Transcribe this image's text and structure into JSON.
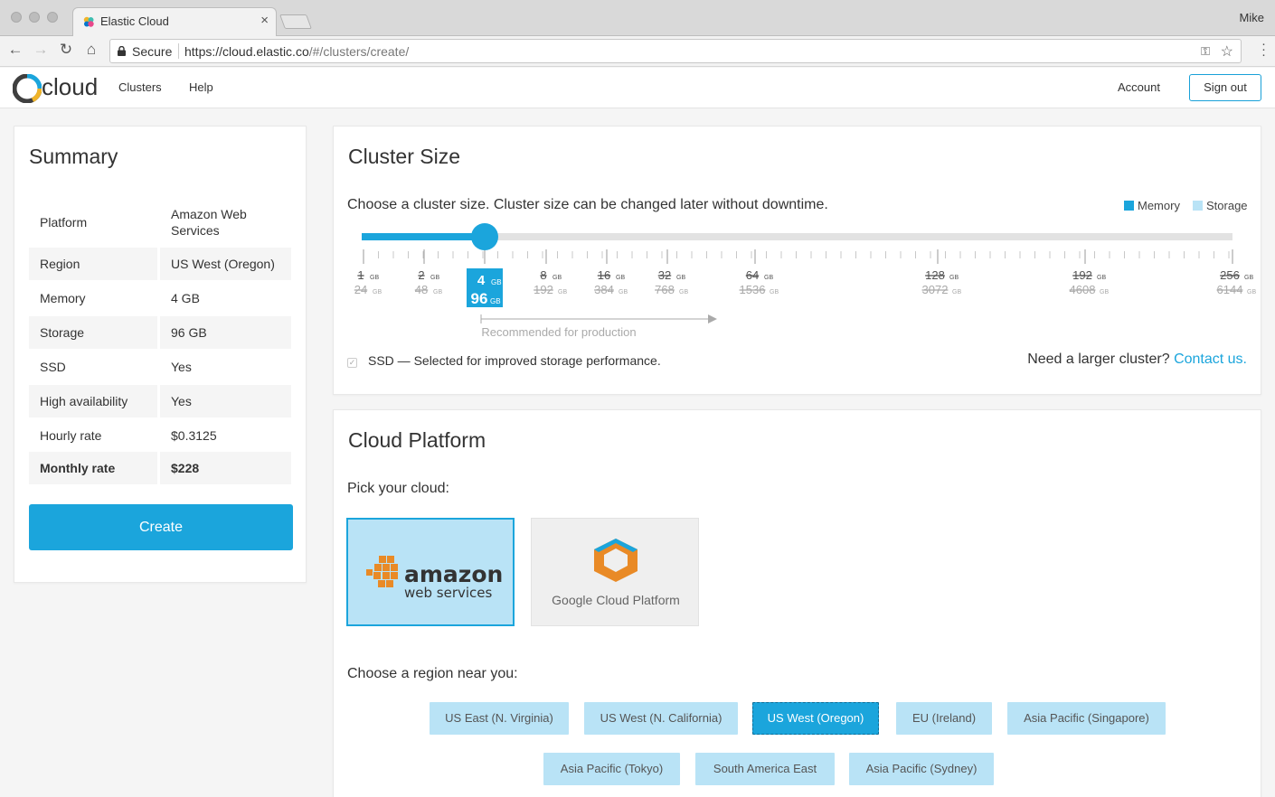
{
  "browser": {
    "tab_title": "Elastic Cloud",
    "user": "Mike",
    "secure_label": "Secure",
    "url_host": "https://cloud.elastic.co",
    "url_path": "/#/clusters/create/"
  },
  "appbar": {
    "logo_text": "cloud",
    "nav": [
      "Clusters",
      "Help"
    ],
    "account": "Account",
    "sign_out": "Sign out"
  },
  "summary": {
    "title": "Summary",
    "rows": [
      {
        "key": "Platform",
        "value": "Amazon Web Services"
      },
      {
        "key": "Region",
        "value": "US West (Oregon)"
      },
      {
        "key": "Memory",
        "value": "4 GB"
      },
      {
        "key": "Storage",
        "value": "96 GB"
      },
      {
        "key": "SSD",
        "value": "Yes"
      },
      {
        "key": "High availability",
        "value": "Yes"
      },
      {
        "key": "Hourly rate",
        "value": "$0.3125"
      },
      {
        "key": "Monthly rate",
        "value": "$228"
      }
    ],
    "create": "Create"
  },
  "cluster_size": {
    "title": "Cluster Size",
    "description": "Choose a cluster size. Cluster size can be changed later without downtime.",
    "legend_memory": "Memory",
    "legend_storage": "Storage",
    "unit": "GB",
    "sizes": [
      {
        "memory": "1",
        "storage": "24"
      },
      {
        "memory": "2",
        "storage": "48"
      },
      {
        "memory": "4",
        "storage": "96"
      },
      {
        "memory": "8",
        "storage": "192"
      },
      {
        "memory": "16",
        "storage": "384"
      },
      {
        "memory": "32",
        "storage": "768"
      },
      {
        "memory": "64",
        "storage": "1536"
      },
      {
        "memory": "128",
        "storage": "3072"
      },
      {
        "memory": "192",
        "storage": "4608"
      },
      {
        "memory": "256",
        "storage": "6144"
      }
    ],
    "selected_index": 2,
    "recommended_label": "Recommended for production",
    "ssd_label": "SSD — Selected for improved storage performance.",
    "larger_text": "Need a larger cluster?",
    "contact_link": "Contact us."
  },
  "platform": {
    "title": "Cloud Platform",
    "pick_label": "Pick your cloud:",
    "aws_word": "amazon",
    "aws_sub": "web services",
    "gcp_name": "Google Cloud Platform",
    "region_label": "Choose a region near you:",
    "regions_row1": [
      "US East (N. Virginia)",
      "US West (N. California)",
      "US West (Oregon)",
      "EU (Ireland)",
      "Asia Pacific (Singapore)"
    ],
    "regions_row2": [
      "Asia Pacific (Tokyo)",
      "South America East",
      "Asia Pacific (Sydney)"
    ],
    "selected_region": "US West (Oregon)"
  },
  "colors": {
    "accent": "#1ba5dc",
    "accent_light": "#b9e3f6",
    "aws_orange": "#e98a26"
  }
}
